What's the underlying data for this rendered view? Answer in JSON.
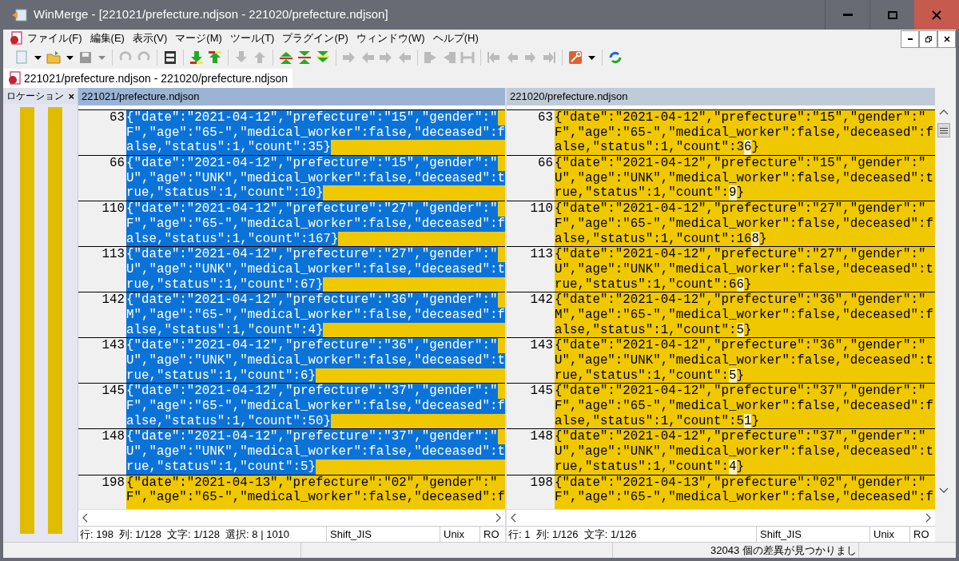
{
  "window": {
    "title": "WinMerge - [221021/prefecture.ndjson - 221020/prefecture.ndjson]"
  },
  "menu": [
    "ファイル(F)",
    "編集(E)",
    "表示(V)",
    "マージ(M)",
    "ツール(T)",
    "プラグイン(P)",
    "ウィンドウ(W)",
    "ヘルプ(H)"
  ],
  "document_tab": {
    "label": "221021/prefecture.ndjson - 221020/prefecture.ndjson",
    "selected": true
  },
  "location_pane": {
    "title": "ロケーション",
    "close": "×"
  },
  "panes": [
    {
      "header": "221021/prefecture.ndjson",
      "blocks": [
        {
          "number": "63",
          "selected": true,
          "lines": [
            [
              {
                "text": "{\"date\":\"2021-04-12\",\"prefecture\":\"15\",\"gender\":\"",
                "changed": false
              }
            ],
            [
              {
                "text": "F\",\"age\":\"65-\",\"medical_worker\":false,\"deceased\":f",
                "changed": false
              }
            ],
            [
              {
                "text": "alse,\"status\":1,\"count\":35}",
                "changed": false
              }
            ]
          ]
        },
        {
          "number": "66",
          "selected": true,
          "lines": [
            [
              {
                "text": "{\"date\":\"2021-04-12\",\"prefecture\":\"15\",\"gender\":\"",
                "changed": false
              }
            ],
            [
              {
                "text": "U\",\"age\":\"UNK\",\"medical_worker\":false,\"deceased\":t",
                "changed": false
              }
            ],
            [
              {
                "text": "rue,\"status\":1,\"count\":10}",
                "changed": false
              }
            ]
          ]
        },
        {
          "number": "110",
          "selected": true,
          "lines": [
            [
              {
                "text": "{\"date\":\"2021-04-12\",\"prefecture\":\"27\",\"gender\":\"",
                "changed": false
              }
            ],
            [
              {
                "text": "F\",\"age\":\"65-\",\"medical_worker\":false,\"deceased\":f",
                "changed": false
              }
            ],
            [
              {
                "text": "alse,\"status\":1,\"count\":167}",
                "changed": false
              }
            ]
          ]
        },
        {
          "number": "113",
          "selected": true,
          "lines": [
            [
              {
                "text": "{\"date\":\"2021-04-12\",\"prefecture\":\"27\",\"gender\":\"",
                "changed": false
              }
            ],
            [
              {
                "text": "U\",\"age\":\"UNK\",\"medical_worker\":false,\"deceased\":t",
                "changed": false
              }
            ],
            [
              {
                "text": "rue,\"status\":1,\"count\":67}",
                "changed": false
              }
            ]
          ]
        },
        {
          "number": "142",
          "selected": true,
          "lines": [
            [
              {
                "text": "{\"date\":\"2021-04-12\",\"prefecture\":\"36\",\"gender\":\"",
                "changed": false
              }
            ],
            [
              {
                "text": "M\",\"age\":\"65-\",\"medical_worker\":false,\"deceased\":f",
                "changed": false
              }
            ],
            [
              {
                "text": "alse,\"status\":1,\"count\":4}",
                "changed": false
              }
            ]
          ]
        },
        {
          "number": "143",
          "selected": true,
          "lines": [
            [
              {
                "text": "{\"date\":\"2021-04-12\",\"prefecture\":\"36\",\"gender\":\"",
                "changed": false
              }
            ],
            [
              {
                "text": "U\",\"age\":\"UNK\",\"medical_worker\":false,\"deceased\":t",
                "changed": false
              }
            ],
            [
              {
                "text": "rue,\"status\":1,\"count\":6}",
                "changed": false
              }
            ]
          ]
        },
        {
          "number": "145",
          "selected": true,
          "lines": [
            [
              {
                "text": "{\"date\":\"2021-04-12\",\"prefecture\":\"37\",\"gender\":\"",
                "changed": false
              }
            ],
            [
              {
                "text": "F\",\"age\":\"65-\",\"medical_worker\":false,\"deceased\":f",
                "changed": false
              }
            ],
            [
              {
                "text": "alse,\"status\":1,\"count\":50}",
                "changed": false
              }
            ]
          ]
        },
        {
          "number": "148",
          "selected": true,
          "lines": [
            [
              {
                "text": "{\"date\":\"2021-04-12\",\"prefecture\":\"37\",\"gender\":\"",
                "changed": false
              }
            ],
            [
              {
                "text": "U\",\"age\":\"UNK\",\"medical_worker\":false,\"deceased\":t",
                "changed": false
              }
            ],
            [
              {
                "text": "rue,\"status\":1,\"count\":5}",
                "changed": false
              }
            ]
          ]
        },
        {
          "number": "198",
          "selected": false,
          "lines": [
            [
              {
                "text": "{\"date\":\"2021-04-13\",\"prefecture\":\"02\",\"gender\":\"",
                "changed": false
              }
            ],
            [
              {
                "text": "F\",\"age\":\"65-\",\"medical_worker\":false,\"deceased\":f",
                "changed": false
              }
            ]
          ]
        }
      ],
      "status": {
        "position": "行: 198  列: 1/128  文字: 1/128  選択: 8 | 1010",
        "encoding": "Shift_JIS",
        "eol": "Unix",
        "mode": "RO"
      }
    },
    {
      "header": "221020/prefecture.ndjson",
      "blocks": [
        {
          "number": "63",
          "selected": false,
          "lines": [
            [
              {
                "text": "{\"date\":\"2021-04-12\",\"prefecture\":\"15\",\"gender\":\"",
                "changed": false
              }
            ],
            [
              {
                "text": "F\",\"age\":\"65-\",\"medical_worker\":false,\"deceased\":f",
                "changed": false
              }
            ],
            [
              {
                "text": "alse,\"status\":1,\"count\":3",
                "changed": false
              },
              {
                "text": "6",
                "changed": true
              },
              {
                "text": "}",
                "changed": false
              }
            ]
          ]
        },
        {
          "number": "66",
          "selected": false,
          "lines": [
            [
              {
                "text": "{\"date\":\"2021-04-12\",\"prefecture\":\"15\",\"gender\":\"",
                "changed": false
              }
            ],
            [
              {
                "text": "U\",\"age\":\"UNK\",\"medical_worker\":false,\"deceased\":t",
                "changed": false
              }
            ],
            [
              {
                "text": "rue,\"status\":1,\"count\":",
                "changed": false
              },
              {
                "text": "9",
                "changed": true
              },
              {
                "text": "}",
                "changed": false
              }
            ]
          ]
        },
        {
          "number": "110",
          "selected": false,
          "lines": [
            [
              {
                "text": "{\"date\":\"2021-04-12\",\"prefecture\":\"27\",\"gender\":\"",
                "changed": false
              }
            ],
            [
              {
                "text": "F\",\"age\":\"65-\",\"medical_worker\":false,\"deceased\":f",
                "changed": false
              }
            ],
            [
              {
                "text": "alse,\"status\":1,\"count\":16",
                "changed": false
              },
              {
                "text": "8",
                "changed": true
              },
              {
                "text": "}",
                "changed": false
              }
            ]
          ]
        },
        {
          "number": "113",
          "selected": false,
          "lines": [
            [
              {
                "text": "{\"date\":\"2021-04-12\",\"prefecture\":\"27\",\"gender\":\"",
                "changed": false
              }
            ],
            [
              {
                "text": "U\",\"age\":\"UNK\",\"medical_worker\":false,\"deceased\":t",
                "changed": false
              }
            ],
            [
              {
                "text": "rue,\"status\":1,\"count\":6",
                "changed": false
              },
              {
                "text": "6",
                "changed": true
              },
              {
                "text": "}",
                "changed": false
              }
            ]
          ]
        },
        {
          "number": "142",
          "selected": false,
          "lines": [
            [
              {
                "text": "{\"date\":\"2021-04-12\",\"prefecture\":\"36\",\"gender\":\"",
                "changed": false
              }
            ],
            [
              {
                "text": "M\",\"age\":\"65-\",\"medical_worker\":false,\"deceased\":f",
                "changed": false
              }
            ],
            [
              {
                "text": "alse,\"status\":1,\"count\":",
                "changed": false
              },
              {
                "text": "5",
                "changed": true
              },
              {
                "text": "}",
                "changed": false
              }
            ]
          ]
        },
        {
          "number": "143",
          "selected": false,
          "lines": [
            [
              {
                "text": "{\"date\":\"2021-04-12\",\"prefecture\":\"36\",\"gender\":\"",
                "changed": false
              }
            ],
            [
              {
                "text": "U\",\"age\":\"UNK\",\"medical_worker\":false,\"deceased\":t",
                "changed": false
              }
            ],
            [
              {
                "text": "rue,\"status\":1,\"count\":",
                "changed": false
              },
              {
                "text": "5",
                "changed": true
              },
              {
                "text": "}",
                "changed": false
              }
            ]
          ]
        },
        {
          "number": "145",
          "selected": false,
          "lines": [
            [
              {
                "text": "{\"date\":\"2021-04-12\",\"prefecture\":\"37\",\"gender\":\"",
                "changed": false
              }
            ],
            [
              {
                "text": "F\",\"age\":\"65-\",\"medical_worker\":false,\"deceased\":f",
                "changed": false
              }
            ],
            [
              {
                "text": "alse,\"status\":1,\"count\":5",
                "changed": false
              },
              {
                "text": "1",
                "changed": true
              },
              {
                "text": "}",
                "changed": false
              }
            ]
          ]
        },
        {
          "number": "148",
          "selected": false,
          "lines": [
            [
              {
                "text": "{\"date\":\"2021-04-12\",\"prefecture\":\"37\",\"gender\":\"",
                "changed": false
              }
            ],
            [
              {
                "text": "U\",\"age\":\"UNK\",\"medical_worker\":false,\"deceased\":t",
                "changed": false
              }
            ],
            [
              {
                "text": "rue,\"status\":1,\"count\":",
                "changed": false
              },
              {
                "text": "4",
                "changed": true
              },
              {
                "text": "}",
                "changed": false
              }
            ]
          ]
        },
        {
          "number": "198",
          "selected": false,
          "lines": [
            [
              {
                "text": "{\"date\":\"2021-04-13\",\"prefecture\":\"02\",\"gender\":\"",
                "changed": false
              }
            ],
            [
              {
                "text": "F\",\"age\":\"65-\",\"medical_worker\":false,\"deceased\":f",
                "changed": false
              }
            ]
          ]
        }
      ],
      "status": {
        "position": "行: 1  列: 1/126  文字: 1/126",
        "encoding": "Shift_JIS",
        "eol": "Unix",
        "mode": "RO"
      }
    }
  ],
  "status_bar": {
    "message": "32043 個の差異が見つかりまし"
  }
}
